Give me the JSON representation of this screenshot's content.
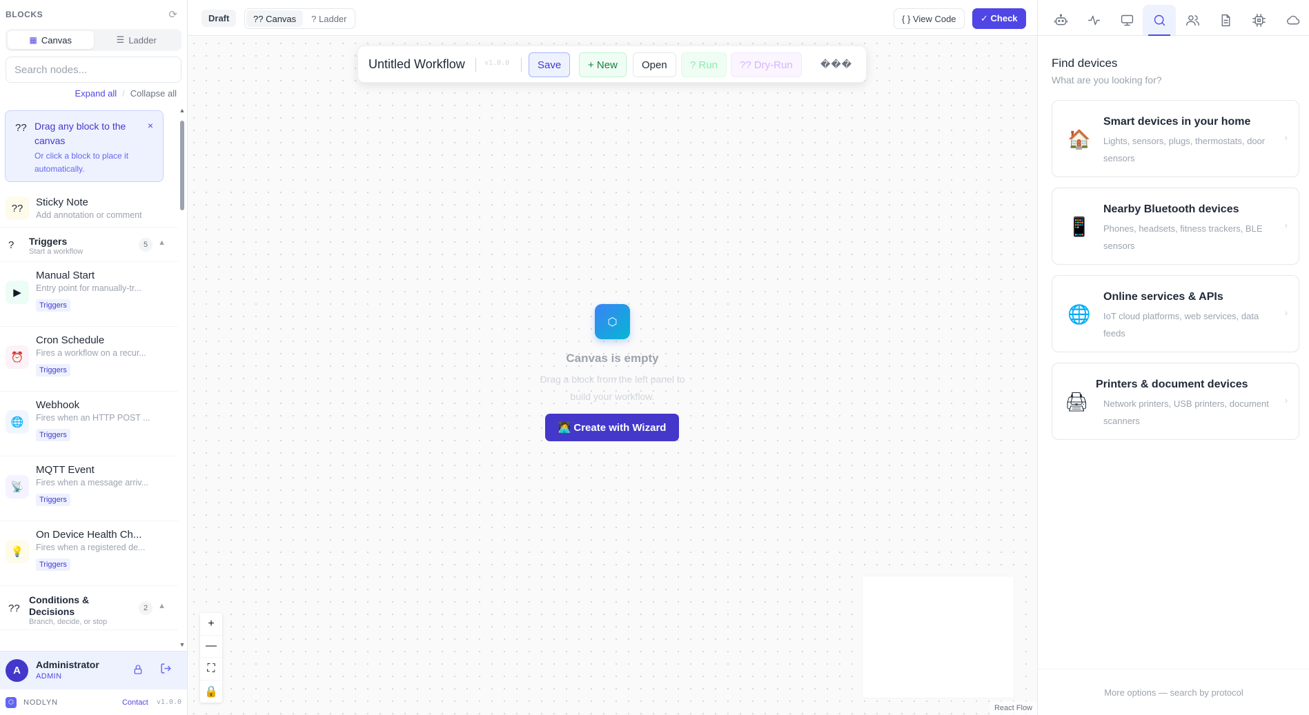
{
  "sidebar": {
    "title": "BLOCKS",
    "view_canvas": "Canvas",
    "view_ladder": "Ladder",
    "search_placeholder": "Search nodes...",
    "expand_all": "Expand all",
    "collapse_all": "Collapse all",
    "hint": {
      "icon": "??",
      "title": "Drag any block to the canvas",
      "subtitle": "Or click a block to place it automatically.",
      "close": "×"
    },
    "sticky": {
      "icon": "??",
      "name": "Sticky Note",
      "desc": "Add annotation or comment"
    },
    "categories": [
      {
        "icon": "?",
        "name": "Triggers",
        "subtitle": "Start a workflow",
        "count": "5"
      },
      {
        "icon": "??",
        "name": "Conditions & Decisions",
        "subtitle": "Branch, decide, or stop",
        "count": "2"
      }
    ],
    "triggers": [
      {
        "icon": "▶",
        "name": "Manual Start",
        "desc": "Entry point for manually-tr...",
        "tag": "Triggers",
        "bg": "#ecfdf5"
      },
      {
        "icon": "⏰",
        "name": "Cron Schedule",
        "desc": "Fires a workflow on a recur...",
        "tag": "Triggers",
        "bg": "#fdf2f8"
      },
      {
        "icon": "🌐",
        "name": "Webhook",
        "desc": "Fires when an HTTP POST ...",
        "tag": "Triggers",
        "bg": "#eff6ff"
      },
      {
        "icon": "📡",
        "name": "MQTT Event",
        "desc": "Fires when a message arriv...",
        "tag": "Triggers",
        "bg": "#f5f3ff"
      },
      {
        "icon": "💡",
        "name": "On Device Health Ch...",
        "desc": "Fires when a registered de...",
        "tag": "Triggers",
        "bg": "#fffbeb"
      }
    ],
    "user": {
      "initial": "A",
      "name": "Administrator",
      "role": "ADMIN"
    },
    "footer": {
      "brand": "NODLYN",
      "contact": "Contact",
      "version": "v1.0.0"
    }
  },
  "topbar": {
    "draft": "Draft",
    "tab_canvas": "?? Canvas",
    "tab_ladder": "? Ladder",
    "view_code": "{ } View Code",
    "check": "✓ Check"
  },
  "workflow": {
    "title": "Untitled Workflow",
    "version": "v1.0.0",
    "save": "Save",
    "new": "+ New",
    "open": "Open",
    "run": "? Run",
    "dry_run": "?? Dry-Run",
    "more": "���"
  },
  "canvas": {
    "empty_title": "Canvas is empty",
    "empty_sub": "Drag a block from the left panel to build your workflow.",
    "wizard": "🧑‍💻 Create with Wizard",
    "zoom_in": "+",
    "zoom_out": "—",
    "fit": "⛶",
    "lock": "🔒",
    "attribution": "React Flow"
  },
  "right_panel": {
    "tabs": [
      "robot-icon",
      "activity-icon",
      "monitor-icon",
      "search-icon",
      "users-icon",
      "document-icon",
      "chip-icon",
      "cloud-icon"
    ],
    "active_tab": "search-icon",
    "title": "Find devices",
    "subtitle": "What are you looking for?",
    "cards": [
      {
        "icon": "🏠",
        "name": "Smart devices in your home",
        "desc": "Lights, sensors, plugs, thermostats, door sensors"
      },
      {
        "icon": "📱",
        "name": "Nearby Bluetooth devices",
        "desc": "Phones, headsets, fitness trackers, BLE sensors"
      },
      {
        "icon": "🌐",
        "name": "Online services & APIs",
        "desc": "IoT cloud platforms, web services, data feeds"
      },
      {
        "icon": "🖨",
        "name": "Printers & document devices",
        "desc": "Network printers, USB printers, document scanners"
      }
    ],
    "more_options": "More options — search by protocol"
  },
  "colors": {
    "accent": "#4f46e5",
    "accent_dark": "#4338ca"
  }
}
